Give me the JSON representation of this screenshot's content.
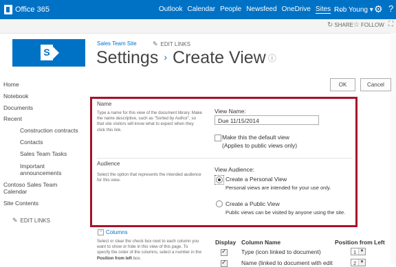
{
  "suite_bar": {
    "brand": "Office 365",
    "nav": [
      "Outlook",
      "Calendar",
      "People",
      "Newsfeed",
      "OneDrive",
      "Sites"
    ],
    "active_nav": "Sites",
    "more": "...",
    "user": "Rob Young ▾",
    "settings_icon": "gear-icon",
    "help": "?"
  },
  "sub_bar": {
    "share": "SHARE",
    "follow": "FOLLOW"
  },
  "header": {
    "site_link": "Sales Team Site",
    "edit_links": "EDIT LINKS",
    "title_part1": "Settings",
    "title_part2": "Create View",
    "separator": "›",
    "info_icon": "ⓘ"
  },
  "left_nav": {
    "items": [
      "Home",
      "Notebook",
      "Documents",
      "Recent",
      "Construction contracts",
      "Contacts",
      "Sales Team Tasks",
      "Important",
      "announcements",
      "Contoso Sales Team",
      "Calendar",
      "Site Contents"
    ],
    "edit_links": "EDIT LINKS"
  },
  "buttons": {
    "ok": "OK",
    "cancel": "Cancel"
  },
  "name_section": {
    "heading": "Name",
    "desc_lines": [
      "Type a name for this view of the document library. Make",
      "the name descriptive, such as \"Sorted by Author\", so",
      "that site visitors will know what to expect when they",
      "click this link."
    ],
    "view_name_label": "View Name:",
    "view_name_value": "Due 11/15/2014",
    "default_view_label": "Make this the default view",
    "default_view_hint": "(Applies to public views only)"
  },
  "audience_section": {
    "heading": "Audience",
    "desc_lines": [
      "Select the option that represents the intended audience",
      "for this view."
    ],
    "view_audience_label": "View Audience:",
    "personal_label": "Create a Personal View",
    "personal_hint": "Personal views are intended for your use only.",
    "public_label": "Create a Public View",
    "public_hint": "Public views can be visited by anyone using the site."
  },
  "columns_section": {
    "toggle_label": "Columns",
    "desc_lines": [
      "Select or clear the check box next to each column you",
      "want to show or hide in this view of this page. To",
      "specify the order of the columns, select a number in the"
    ],
    "desc_bold": "Position from left",
    "desc_tail": " box.",
    "headers": {
      "display": "Display",
      "column_name": "Column Name",
      "position": "Position from Left"
    },
    "rows": [
      {
        "name": "Type (icon linked to document)",
        "checked": true,
        "position": "1"
      },
      {
        "name": "Name (linked to document with edit",
        "checked": true,
        "position": "2"
      }
    ]
  }
}
